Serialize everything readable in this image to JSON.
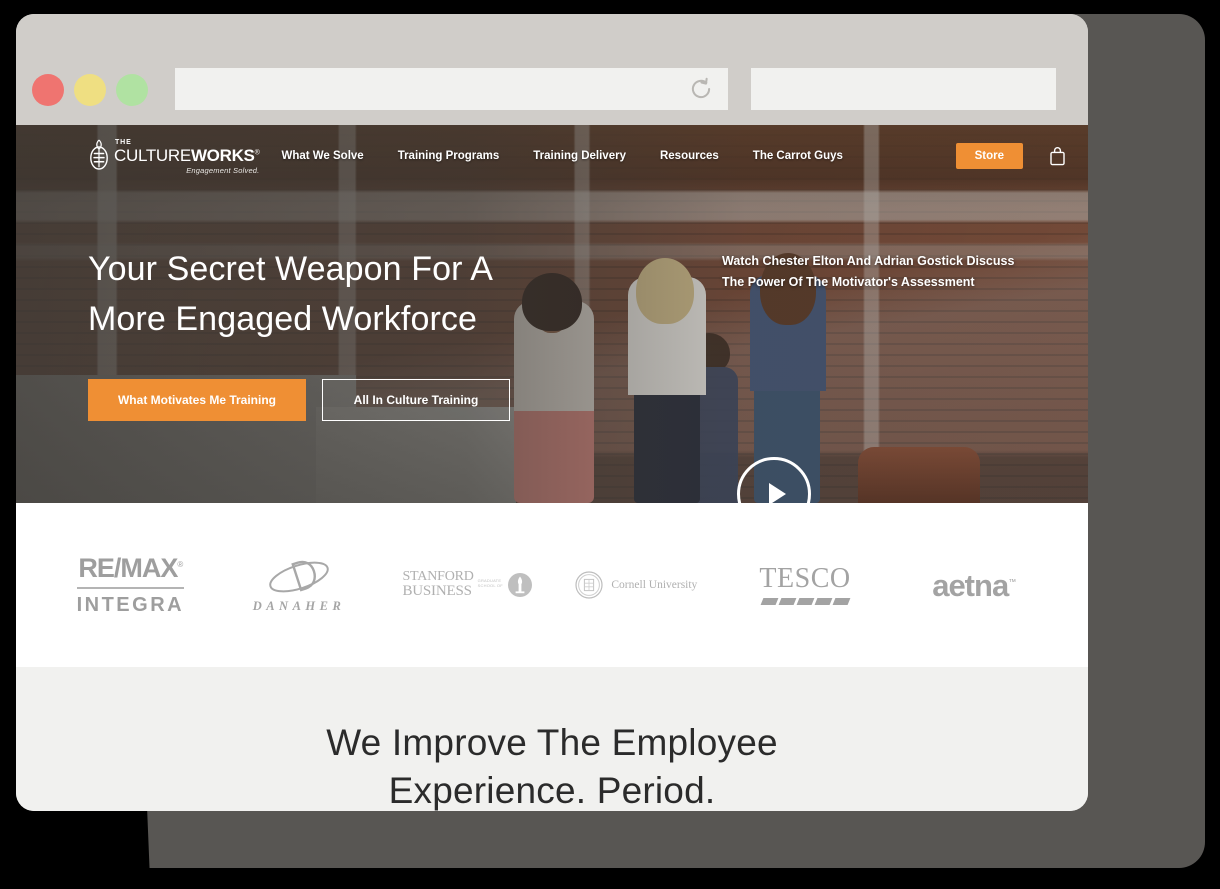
{
  "browser": {
    "traffic_lights": [
      {
        "name": "close",
        "color": "#ef7470"
      },
      {
        "name": "minimize",
        "color": "#efdf82"
      },
      {
        "name": "zoom",
        "color": "#b0e2a2"
      }
    ],
    "url_bar": {
      "value": "",
      "placeholder": ""
    },
    "reload_icon": "reload-icon",
    "search_bar": {
      "value": "",
      "placeholder": ""
    }
  },
  "site": {
    "brand": {
      "eyebrow": "THE",
      "name_light": "CULTURE",
      "name_bold": "WORKS",
      "registered": "®",
      "tagline": "Engagement Solved.",
      "mark_icon": "culture-works-emblem-icon"
    },
    "nav": {
      "links": [
        {
          "label": "What We Solve"
        },
        {
          "label": "Training Programs"
        },
        {
          "label": "Training Delivery"
        },
        {
          "label": "Resources"
        },
        {
          "label": "The Carrot Guys"
        }
      ],
      "store_label": "Store",
      "store_color": "#ef8f34",
      "cart_icon": "shopping-bag-icon"
    },
    "hero": {
      "title_line_1": "Your Secret Weapon For A",
      "title_line_2": "More Engaged Workforce",
      "cta_primary": "What Motivates Me Training",
      "cta_secondary": "All In Culture Training",
      "video_caption_line_1": "Watch Chester Elton And Adrian Gostick Discuss",
      "video_caption_line_2": "The Power Of The Motivator's Assessment",
      "play_icon": "play-icon"
    },
    "logos": [
      {
        "name": "remax-integra",
        "top": "RE/MAX",
        "registered": "®",
        "bottom": "INTEGRA"
      },
      {
        "name": "danaher",
        "word": "DANAHER"
      },
      {
        "name": "stanford-business",
        "word_1": "STANFORD",
        "word_2": "BUSINESS",
        "sub_1": "GRADUATE",
        "sub_2": "SCHOOL OF"
      },
      {
        "name": "cornell-university",
        "word": "Cornell University"
      },
      {
        "name": "tesco",
        "word": "TESCO"
      },
      {
        "name": "aetna",
        "word": "aetna",
        "tm": "™"
      }
    ],
    "bottom_section": {
      "headline_line_1": "We Improve The Employee",
      "headline_line_2": "Experience. Period."
    }
  },
  "theme": {
    "accent_orange": "#ef8f34",
    "chrome_gray": "#d0cdc9",
    "page_gray": "#f1f1ef",
    "shadow_gray": "#585653",
    "logo_gray": "#a3a3a3"
  }
}
